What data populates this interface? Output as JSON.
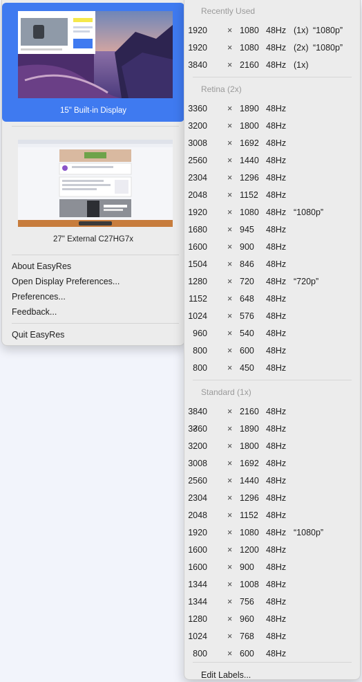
{
  "left_menu": {
    "displays": [
      {
        "label": "15\" Built-in Display",
        "selected": true
      },
      {
        "label": "27\" External C27HG7x",
        "selected": false
      }
    ],
    "items": [
      "About EasyRes",
      "Open Display Preferences...",
      "Preferences...",
      "Feedback..."
    ],
    "quit": "Quit EasyRes"
  },
  "resolution_menu": {
    "separator": "×",
    "check_mark": "✓",
    "sections": [
      {
        "title": "Recently Used",
        "rows": [
          {
            "w": "1920",
            "h": "1080",
            "hz": "48Hz",
            "scale": "(1x)",
            "tag": "“1080p”"
          },
          {
            "w": "1920",
            "h": "1080",
            "hz": "48Hz",
            "scale": "(2x)",
            "tag": "“1080p”"
          },
          {
            "w": "3840",
            "h": "2160",
            "hz": "48Hz",
            "scale": "(1x)",
            "tag": ""
          }
        ]
      },
      {
        "title": "Retina (2x)",
        "rows": [
          {
            "w": "3360",
            "h": "1890",
            "hz": "48Hz",
            "scale": "",
            "tag": ""
          },
          {
            "w": "3200",
            "h": "1800",
            "hz": "48Hz",
            "scale": "",
            "tag": ""
          },
          {
            "w": "3008",
            "h": "1692",
            "hz": "48Hz",
            "scale": "",
            "tag": ""
          },
          {
            "w": "2560",
            "h": "1440",
            "hz": "48Hz",
            "scale": "",
            "tag": ""
          },
          {
            "w": "2304",
            "h": "1296",
            "hz": "48Hz",
            "scale": "",
            "tag": ""
          },
          {
            "w": "2048",
            "h": "1152",
            "hz": "48Hz",
            "scale": "",
            "tag": ""
          },
          {
            "w": "1920",
            "h": "1080",
            "hz": "48Hz",
            "scale": "",
            "tag": "“1080p”"
          },
          {
            "w": "1680",
            "h": "945",
            "hz": "48Hz",
            "scale": "",
            "tag": ""
          },
          {
            "w": "1600",
            "h": "900",
            "hz": "48Hz",
            "scale": "",
            "tag": ""
          },
          {
            "w": "1504",
            "h": "846",
            "hz": "48Hz",
            "scale": "",
            "tag": ""
          },
          {
            "w": "1280",
            "h": "720",
            "hz": "48Hz",
            "scale": "",
            "tag": "“720p”"
          },
          {
            "w": "1152",
            "h": "648",
            "hz": "48Hz",
            "scale": "",
            "tag": ""
          },
          {
            "w": "1024",
            "h": "576",
            "hz": "48Hz",
            "scale": "",
            "tag": ""
          },
          {
            "w": "960",
            "h": "540",
            "hz": "48Hz",
            "scale": "",
            "tag": ""
          },
          {
            "w": "800",
            "h": "600",
            "hz": "48Hz",
            "scale": "",
            "tag": ""
          },
          {
            "w": "800",
            "h": "450",
            "hz": "48Hz",
            "scale": "",
            "tag": ""
          }
        ]
      },
      {
        "title": "Standard (1x)",
        "rows": [
          {
            "w": "3840",
            "h": "2160",
            "hz": "48Hz",
            "scale": "",
            "tag": ""
          },
          {
            "w": "3360",
            "h": "1890",
            "hz": "48Hz",
            "scale": "",
            "tag": "",
            "checked": true
          },
          {
            "w": "3200",
            "h": "1800",
            "hz": "48Hz",
            "scale": "",
            "tag": ""
          },
          {
            "w": "3008",
            "h": "1692",
            "hz": "48Hz",
            "scale": "",
            "tag": ""
          },
          {
            "w": "2560",
            "h": "1440",
            "hz": "48Hz",
            "scale": "",
            "tag": ""
          },
          {
            "w": "2304",
            "h": "1296",
            "hz": "48Hz",
            "scale": "",
            "tag": ""
          },
          {
            "w": "2048",
            "h": "1152",
            "hz": "48Hz",
            "scale": "",
            "tag": ""
          },
          {
            "w": "1920",
            "h": "1080",
            "hz": "48Hz",
            "scale": "",
            "tag": "“1080p”"
          },
          {
            "w": "1600",
            "h": "1200",
            "hz": "48Hz",
            "scale": "",
            "tag": ""
          },
          {
            "w": "1600",
            "h": "900",
            "hz": "48Hz",
            "scale": "",
            "tag": ""
          },
          {
            "w": "1344",
            "h": "1008",
            "hz": "48Hz",
            "scale": "",
            "tag": ""
          },
          {
            "w": "1344",
            "h": "756",
            "hz": "48Hz",
            "scale": "",
            "tag": ""
          },
          {
            "w": "1280",
            "h": "960",
            "hz": "48Hz",
            "scale": "",
            "tag": ""
          },
          {
            "w": "1024",
            "h": "768",
            "hz": "48Hz",
            "scale": "",
            "tag": ""
          },
          {
            "w": "800",
            "h": "600",
            "hz": "48Hz",
            "scale": "",
            "tag": ""
          }
        ]
      }
    ],
    "edit_labels": "Edit Labels..."
  },
  "colors": {
    "selection_blue": "#3f7af0",
    "menu_background": "#ececec",
    "section_header": "#9a9a9a"
  },
  "icons": [
    "checkmark-icon"
  ]
}
